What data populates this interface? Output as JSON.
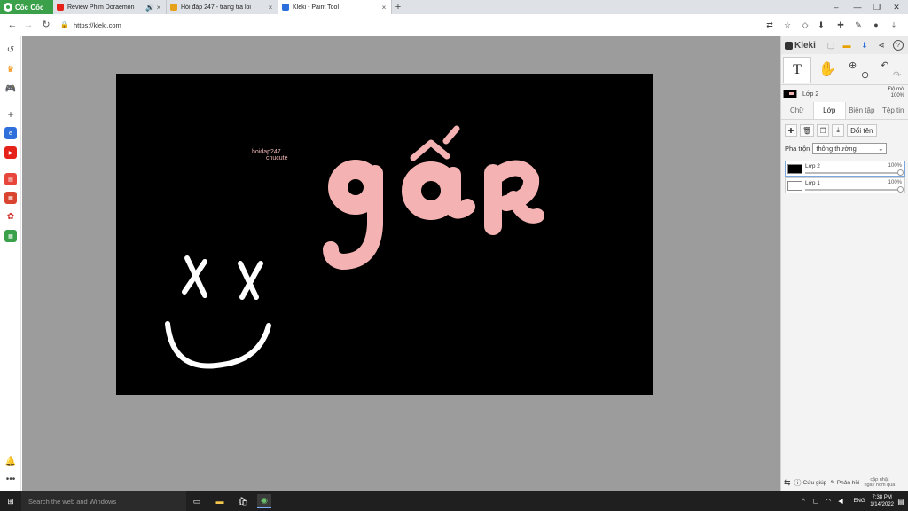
{
  "browser": {
    "brand": "Cốc Cốc",
    "tabs": [
      {
        "title": "Review Phim Doraemon",
        "favicon_color": "#e62117",
        "active": false
      },
      {
        "title": "Hỏi đáp 247 - trang tra loi",
        "favicon_color": "#e7a21c",
        "active": false
      },
      {
        "title": "Kleki - Paint Tool",
        "favicon_color": "#2a6fdb",
        "active": true
      }
    ],
    "url": "https://kleki.com"
  },
  "canvas": {
    "watermark_line1": "hoidap247",
    "watermark_line2": "chucute",
    "text_art": "gấp",
    "text_color": "#f4b2b2",
    "bg_color": "#000000"
  },
  "panel": {
    "logo": "Kleki",
    "tool_label": "T",
    "current_layer": "Lớp 2",
    "opacity_label": "Độ mờ",
    "opacity_value": "100%",
    "tabs": [
      "Chữ",
      "Lớp",
      "Biên tập",
      "Tệp tin"
    ],
    "active_tab": "Lớp",
    "rename_label": "Đổi tên",
    "blend_label": "Pha trộn",
    "blend_value": "thông thường",
    "layers": [
      {
        "name": "Lớp 2",
        "opacity": "100%"
      },
      {
        "name": "Lớp 1",
        "opacity": "100%"
      }
    ],
    "help": "Cứu giúp",
    "feedback": "Phản hồi",
    "updated_line1": "cập nhật",
    "updated_line2": "ngày hôm qua"
  },
  "taskbar": {
    "search_placeholder": "Search the web and Windows",
    "lang": "ENG",
    "time": "7:38 PM",
    "date": "1/14/2022"
  }
}
